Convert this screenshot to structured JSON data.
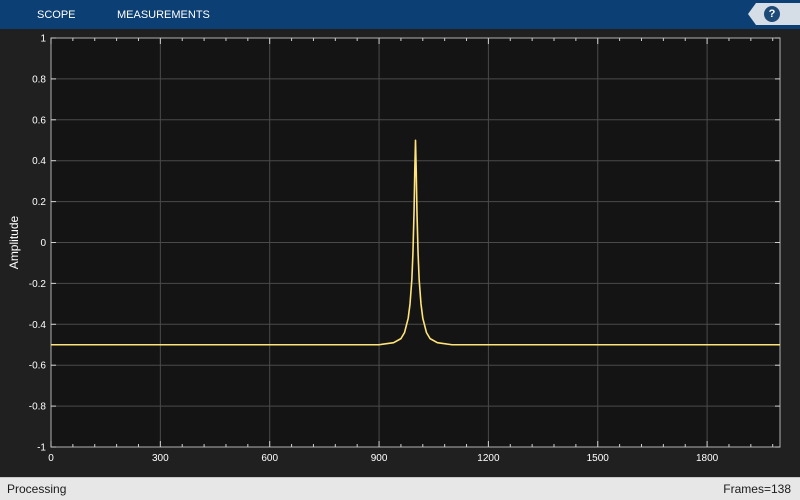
{
  "toolstrip": {
    "tabs": [
      "SCOPE",
      "MEASUREMENTS"
    ],
    "help_label": "?"
  },
  "status": {
    "left": "Processing",
    "right": "Frames=138"
  },
  "colors": {
    "toolstrip": "#0c3f73",
    "plot_background": "#141414",
    "grid": "#4a4a4a",
    "trace": "#ffe47a",
    "axis_text": "#ffffff"
  },
  "chart_data": {
    "type": "line",
    "ylabel": "Amplitude",
    "xlabel": "",
    "xlim": [
      0,
      2000
    ],
    "ylim": [
      -1,
      1
    ],
    "xticks": [
      0,
      300,
      600,
      900,
      1200,
      1500,
      1800
    ],
    "yticks": [
      1,
      0.8,
      0.6,
      0.4,
      0.2,
      0,
      -0.2,
      -0.4,
      -0.6,
      -0.8,
      -1
    ],
    "grid": true,
    "series": [
      {
        "baseline": -0.5,
        "x": [
          0,
          900,
          940,
          960,
          970,
          980,
          985,
          990,
          993,
          996,
          998,
          1000,
          1002,
          1004,
          1007,
          1010,
          1015,
          1020,
          1030,
          1040,
          1060,
          1100,
          1200,
          1500,
          2000
        ],
        "y": [
          -0.5,
          -0.5,
          -0.49,
          -0.47,
          -0.44,
          -0.37,
          -0.3,
          -0.18,
          -0.05,
          0.15,
          0.35,
          0.5,
          0.35,
          0.15,
          -0.05,
          -0.18,
          -0.3,
          -0.37,
          -0.44,
          -0.47,
          -0.49,
          -0.5,
          -0.5,
          -0.5,
          -0.5
        ]
      }
    ]
  }
}
